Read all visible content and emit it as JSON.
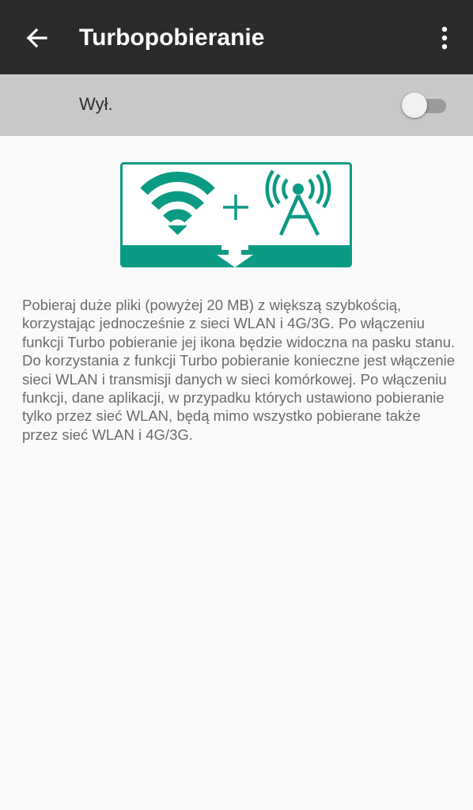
{
  "toolbar": {
    "title": "Turbopobieranie",
    "back_icon": "arrow-back-icon",
    "menu_icon": "more-vert-icon"
  },
  "switch_row": {
    "label": "Wył.",
    "checked": false
  },
  "illustration": {
    "icons": [
      "wifi-icon",
      "plus-icon",
      "cell-tower-icon",
      "download-arrow-icon"
    ],
    "accent_color": "#0b9a84"
  },
  "description": "Pobieraj duże pliki (powyżej 20 MB) z większą szybkością, korzystając jednocześnie z sieci WLAN i 4G/3G. Po włączeniu funkcji Turbo pobieranie jej ikona będzie widoczna na pasku stanu. Do korzystania z funkcji Turbo pobieranie konieczne jest włączenie sieci WLAN i transmisji danych w sieci komórkowej. Po włączeniu funkcji, dane aplikacji, w przypadku których ustawiono pobieranie tylko przez sieć WLAN, będą mimo wszystko pobierane także przez sieć WLAN i 4G/3G.",
  "colors": {
    "toolbar_bg": "#2b2b2b",
    "switch_bar_bg": "#c9c9c9",
    "page_bg": "#fafafa",
    "accent": "#0b9a84"
  }
}
